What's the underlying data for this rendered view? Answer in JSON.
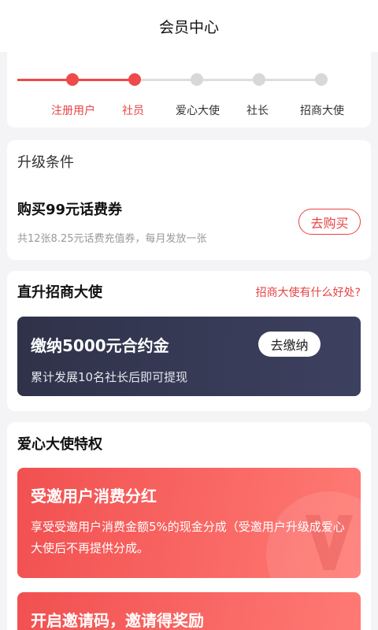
{
  "header": {
    "title": "会员中心"
  },
  "progress": {
    "filled_fraction": 0.378,
    "steps": [
      {
        "label": "注册用户",
        "active": true
      },
      {
        "label": "社员",
        "active": true
      },
      {
        "label": "爱心大使",
        "active": false
      },
      {
        "label": "社长",
        "active": false
      },
      {
        "label": "招商大使",
        "active": false
      }
    ]
  },
  "upgrade": {
    "title": "升级条件",
    "item_title": "购买99元话费券",
    "item_sub": "共12张8.25元话费充值券，每月发放一张",
    "buy_label": "去购买"
  },
  "direct": {
    "title": "直升招商大使",
    "benefit_link": "招商大使有什么好处?",
    "card_title": "缴纳5000元合约金",
    "card_sub": "累计发展10名社长后即可提现",
    "pay_label": "去缴纳"
  },
  "privileges": {
    "title": "爱心大使特权",
    "items": [
      {
        "title": "受邀用户消费分红",
        "desc": "享受受邀用户消费金额5%的现金分成（受邀用户升级成爱心大使后不再提供分成。"
      },
      {
        "title": "开启邀请码，邀请得奖励",
        "desc": ""
      }
    ]
  },
  "colors": {
    "accent": "#ef4a4a",
    "dark_card": "#2f3249",
    "background": "#f4f4f6"
  }
}
